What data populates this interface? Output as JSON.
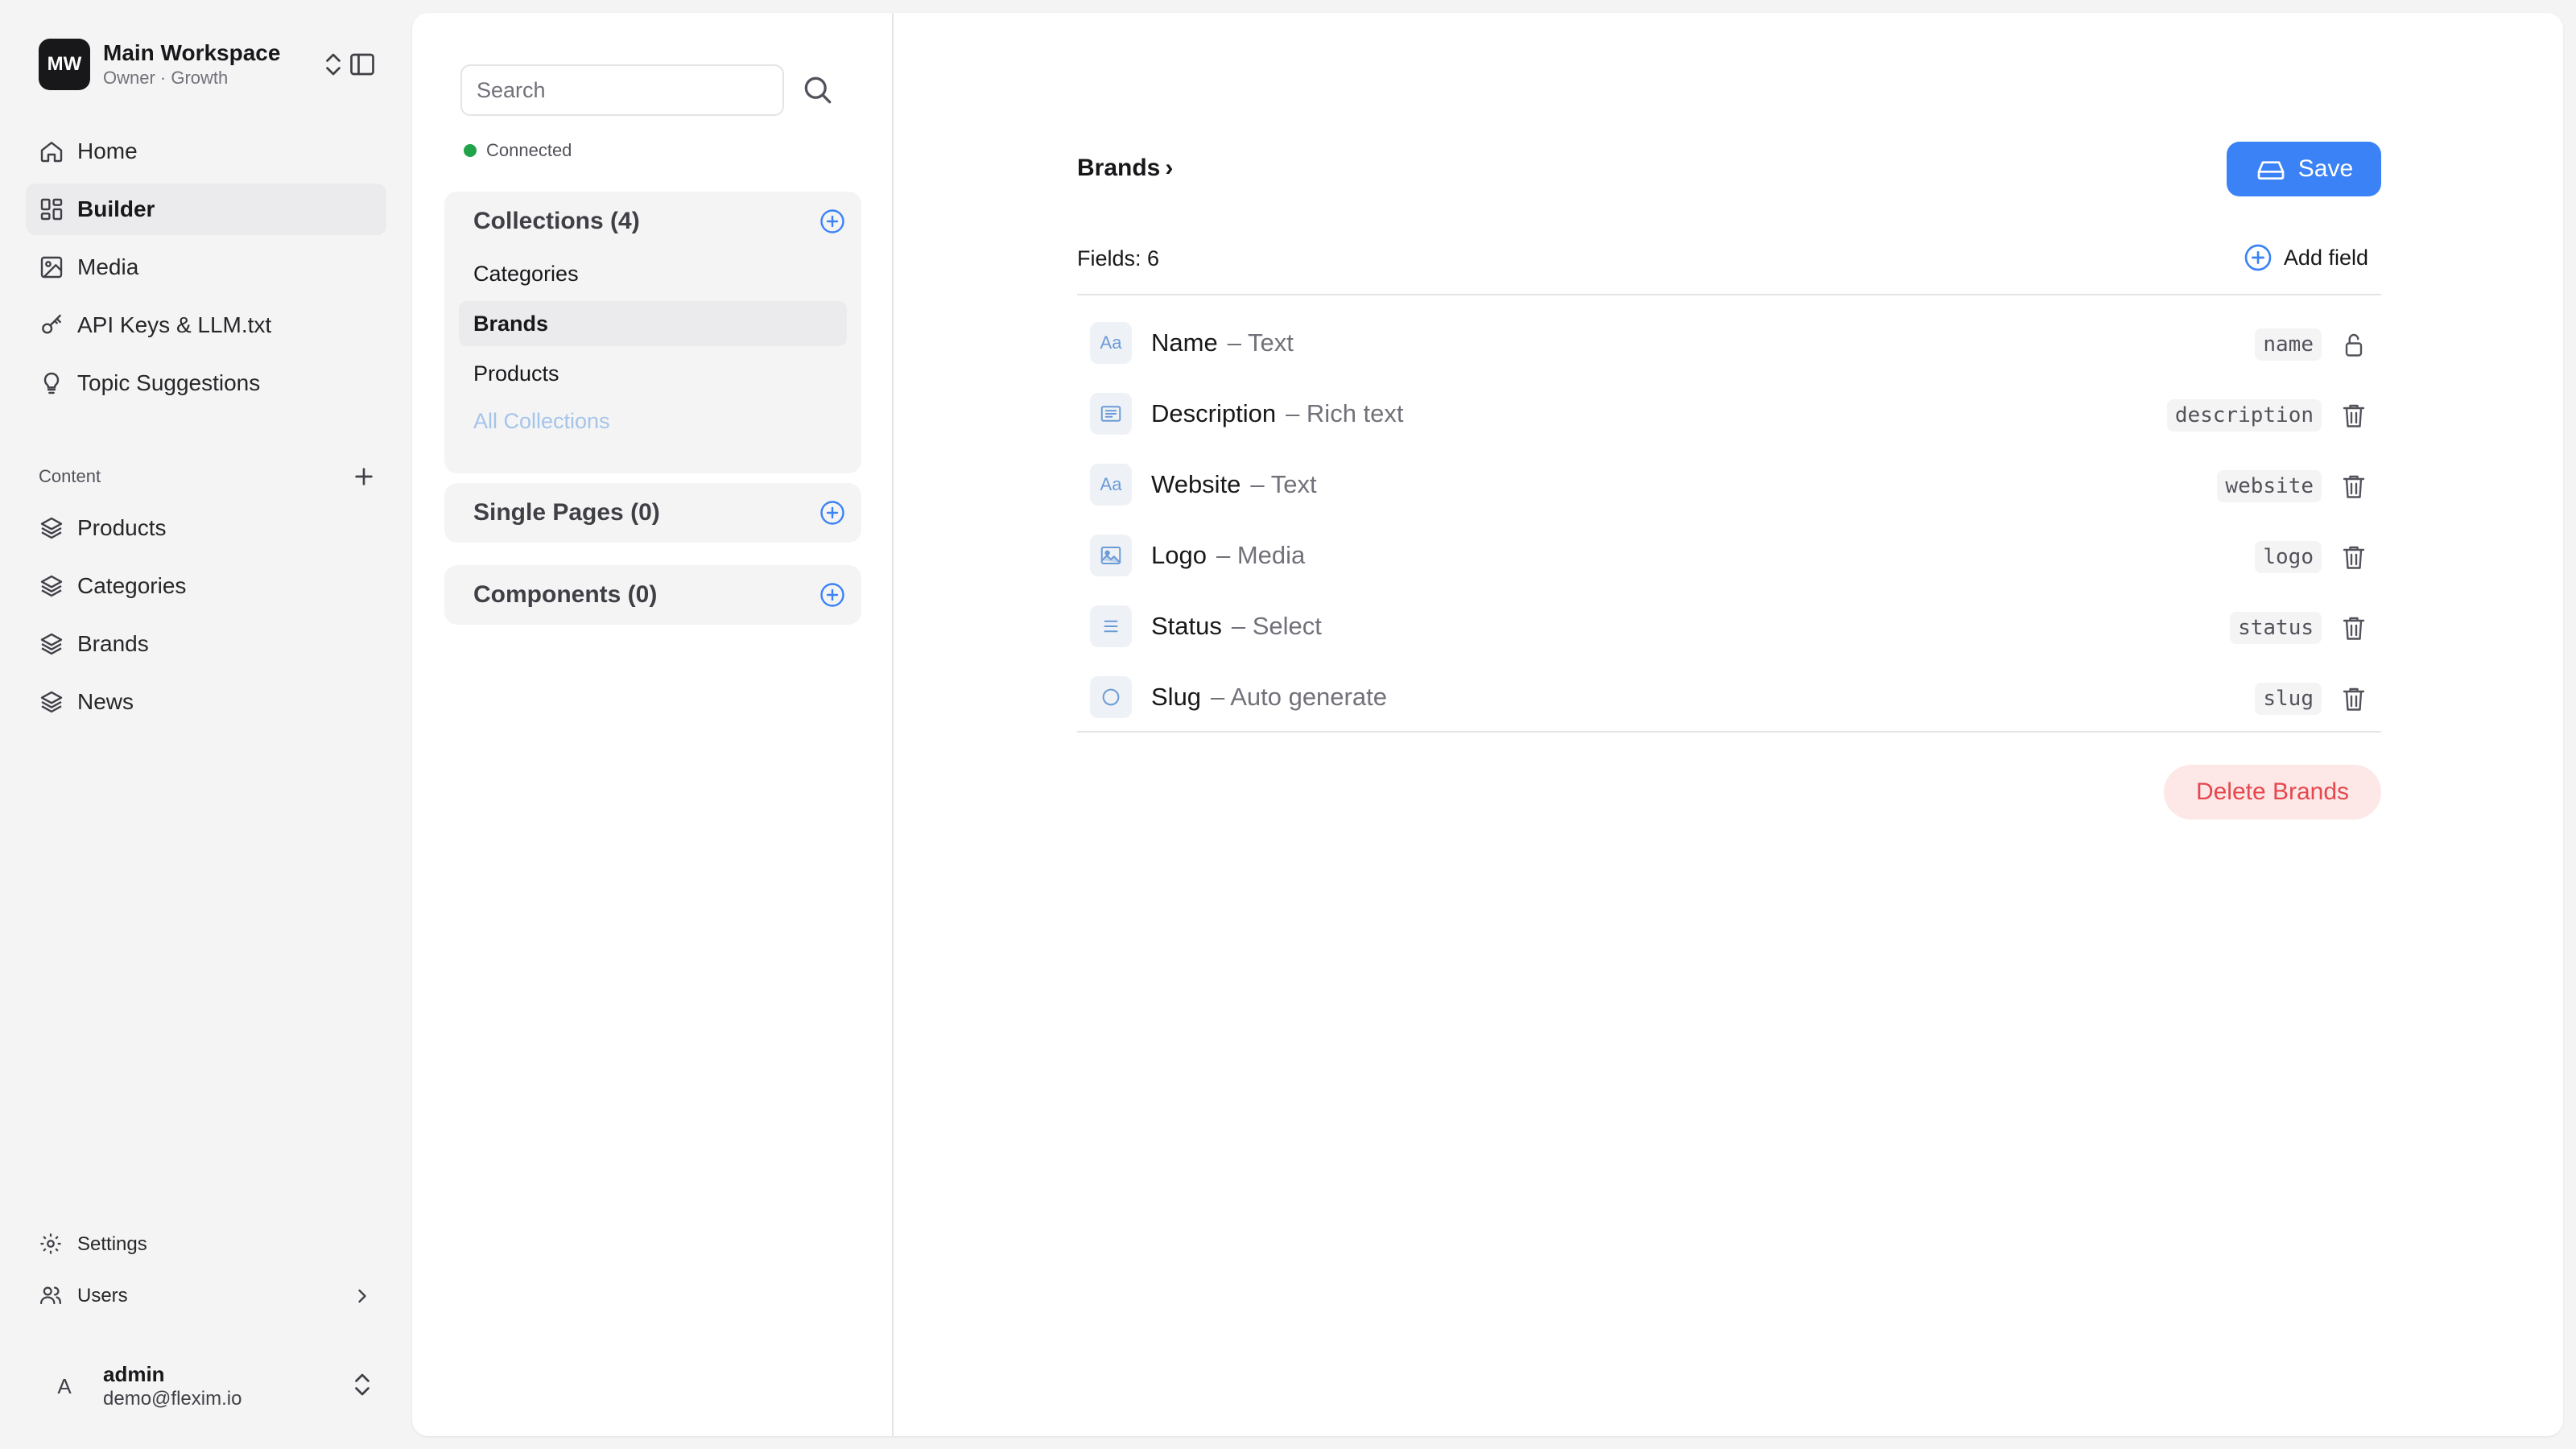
{
  "workspace": {
    "initials": "MW",
    "name": "Main Workspace",
    "subtitle": "Owner · Growth"
  },
  "nav": [
    {
      "label": "Home",
      "icon": "home-icon"
    },
    {
      "label": "Builder",
      "icon": "grid-icon",
      "active": true
    },
    {
      "label": "Media",
      "icon": "image-icon"
    },
    {
      "label": "API Keys & LLM.txt",
      "icon": "key-icon"
    },
    {
      "label": "Topic Suggestions",
      "icon": "lightbulb-icon"
    }
  ],
  "content_section": {
    "label": "Content",
    "items": [
      {
        "label": "Products",
        "icon": "layers-icon"
      },
      {
        "label": "Categories",
        "icon": "layers-icon"
      },
      {
        "label": "Brands",
        "icon": "layers-icon"
      },
      {
        "label": "News",
        "icon": "layers-icon"
      }
    ]
  },
  "bottom_nav": [
    {
      "label": "Settings",
      "icon": "gear-icon"
    },
    {
      "label": "Users",
      "icon": "users-icon"
    }
  ],
  "user": {
    "initial": "A",
    "name": "admin",
    "email": "demo@flexim.io"
  },
  "search": {
    "placeholder": "Search",
    "value": ""
  },
  "connection": {
    "status": "Connected",
    "color": "#22a34a"
  },
  "collections": {
    "title": "Collections (4)",
    "items": [
      {
        "label": "Categories"
      },
      {
        "label": "Brands",
        "active": true
      },
      {
        "label": "Products"
      }
    ],
    "all_label": "All Collections"
  },
  "single_pages": {
    "title": "Single Pages (0)"
  },
  "components": {
    "title": "Components (0)"
  },
  "editor": {
    "breadcrumb": "Brands",
    "breadcrumb_sep": "›",
    "save_label": "Save",
    "fields_count": "Fields: 6",
    "add_field_label": "Add field",
    "delete_label": "Delete Brands",
    "accent_color": "#3b82f6",
    "danger_color": "#e5484d"
  },
  "fields": [
    {
      "name": "Name",
      "type": "– Text",
      "key": "name",
      "icon": "text-aa-icon",
      "icon_text": "Aa",
      "action": "lock-icon"
    },
    {
      "name": "Description",
      "type": "– Rich text",
      "key": "description",
      "icon": "rich-text-icon",
      "icon_text": "",
      "action": "trash-icon"
    },
    {
      "name": "Website",
      "type": "– Text",
      "key": "website",
      "icon": "text-aa-icon",
      "icon_text": "Aa",
      "action": "trash-icon"
    },
    {
      "name": "Logo",
      "type": "– Media",
      "key": "logo",
      "icon": "image-icon",
      "icon_text": "",
      "action": "trash-icon"
    },
    {
      "name": "Status",
      "type": "– Select",
      "key": "status",
      "icon": "list-icon",
      "icon_text": "",
      "action": "trash-icon"
    },
    {
      "name": "Slug",
      "type": "– Auto generate",
      "key": "slug",
      "icon": "circle-icon",
      "icon_text": "",
      "action": "trash-icon"
    }
  ]
}
